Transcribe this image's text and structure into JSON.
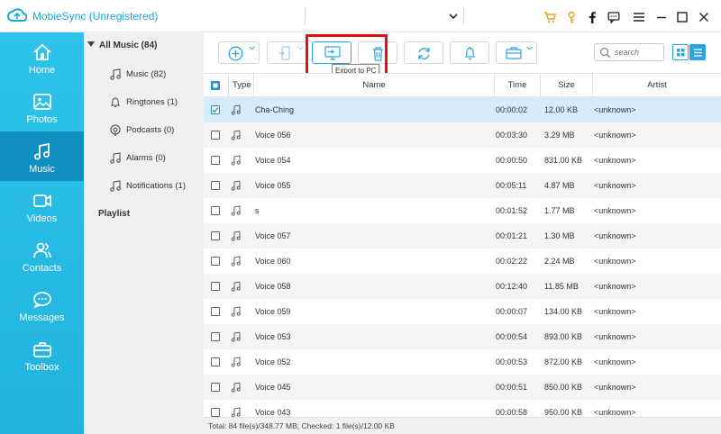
{
  "app": {
    "title": "MobieSync (Unregistered)",
    "accent": "#19a8d8",
    "window_icons": [
      "cart-icon",
      "key-icon",
      "facebook-icon",
      "feedback-icon",
      "menu-icon",
      "minimize-icon",
      "maximize-icon",
      "close-icon"
    ]
  },
  "sidebar": {
    "items": [
      {
        "label": "Home",
        "icon": "home-icon"
      },
      {
        "label": "Photos",
        "icon": "photos-icon"
      },
      {
        "label": "Music",
        "icon": "music-icon",
        "active": true
      },
      {
        "label": "Videos",
        "icon": "videos-icon"
      },
      {
        "label": "Contacts",
        "icon": "contacts-icon"
      },
      {
        "label": "Messages",
        "icon": "messages-icon"
      },
      {
        "label": "Toolbox",
        "icon": "toolbox-icon"
      }
    ]
  },
  "categories": {
    "header": "All Music (84)",
    "items": [
      {
        "label": "Music (82)",
        "icon": "music-note-icon"
      },
      {
        "label": "Ringtones (1)",
        "icon": "bell-icon"
      },
      {
        "label": "Podcasts (0)",
        "icon": "podcast-icon"
      },
      {
        "label": "Alarms (0)",
        "icon": "music-note-icon"
      },
      {
        "label": "Notifications (1)",
        "icon": "music-note-icon"
      }
    ],
    "playlist_label": "Playlist"
  },
  "toolbar": {
    "tooltip": "Export to PC",
    "search_placeholder": "search",
    "highlight_color": "#e01010"
  },
  "table": {
    "columns": [
      "Type",
      "Name",
      "Time",
      "Size",
      "Artist"
    ],
    "rows": [
      {
        "name": "Cha-Ching",
        "time": "00:00:02",
        "size": "12.00 KB",
        "artist": "<unknown>",
        "checked": true
      },
      {
        "name": "Voice 056",
        "time": "00:03:30",
        "size": "3.29 MB",
        "artist": "<unknown>",
        "checked": false
      },
      {
        "name": "Voice 054",
        "time": "00:00:50",
        "size": "831.00 KB",
        "artist": "<unknown>",
        "checked": false
      },
      {
        "name": "Voice 055",
        "time": "00:05:11",
        "size": "4.87 MB",
        "artist": "<unknown>",
        "checked": false
      },
      {
        "name": "s",
        "time": "00:01:52",
        "size": "1.77 MB",
        "artist": "<unknown>",
        "checked": false
      },
      {
        "name": "Voice 057",
        "time": "00:01:21",
        "size": "1.30 MB",
        "artist": "<unknown>",
        "checked": false
      },
      {
        "name": "Voice 060",
        "time": "00:02:22",
        "size": "2.24 MB",
        "artist": "<unknown>",
        "checked": false
      },
      {
        "name": "Voice 058",
        "time": "00:12:40",
        "size": "11.85 MB",
        "artist": "<unknown>",
        "checked": false
      },
      {
        "name": "Voice 059",
        "time": "00:00:07",
        "size": "134.00 KB",
        "artist": "<unknown>",
        "checked": false
      },
      {
        "name": "Voice 053",
        "time": "00:00:54",
        "size": "893.00 KB",
        "artist": "<unknown>",
        "checked": false
      },
      {
        "name": "Voice 052",
        "time": "00:00:53",
        "size": "872.00 KB",
        "artist": "<unknown>",
        "checked": false
      },
      {
        "name": "Voice 045",
        "time": "00:00:51",
        "size": "850.00 KB",
        "artist": "<unknown>",
        "checked": false
      },
      {
        "name": "Voice 043",
        "time": "00:00:58",
        "size": "950.00 KB",
        "artist": "<unknown>",
        "checked": false
      }
    ]
  },
  "status": {
    "text": "Total: 84 file(s)/348.77 MB; Checked: 1 file(s)/12.00 KB"
  }
}
